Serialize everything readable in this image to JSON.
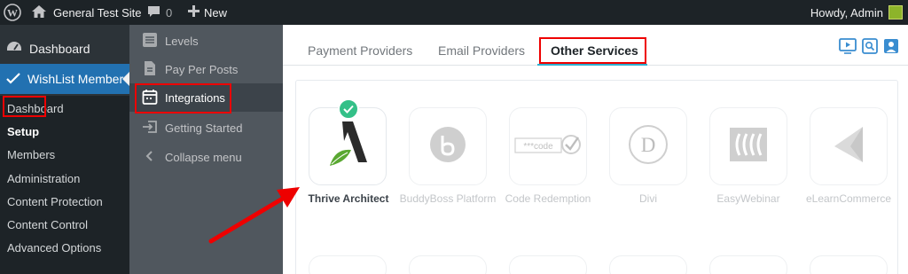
{
  "admin_bar": {
    "site_name": "General Test Site",
    "comments_count": "0",
    "new_label": "New",
    "howdy": "Howdy, Admin"
  },
  "sidebar": {
    "dashboard": "Dashboard",
    "wishlist_member": "WishList Member",
    "submenu": [
      "Dashboard",
      "Setup",
      "Members",
      "Administration",
      "Content Protection",
      "Content Control",
      "Advanced Options"
    ]
  },
  "flyout": {
    "items": [
      "Levels",
      "Pay Per Posts",
      "Integrations",
      "Getting Started",
      "Collapse menu"
    ]
  },
  "tabs": [
    "Payment Providers",
    "Email Providers",
    "Other Services"
  ],
  "integrations": [
    {
      "name": "Thrive Architect",
      "selected": true
    },
    {
      "name": "BuddyBoss Platform"
    },
    {
      "name": "Code Redemption",
      "code_text": "***code"
    },
    {
      "name": "Divi",
      "letter": "D"
    },
    {
      "name": "EasyWebinar"
    },
    {
      "name": "eLearnCommerce"
    }
  ],
  "colors": {
    "accent": "#2271b1",
    "highlight": "#ee0000",
    "check": "#34c088",
    "tab_underline": "#2db0d0"
  }
}
